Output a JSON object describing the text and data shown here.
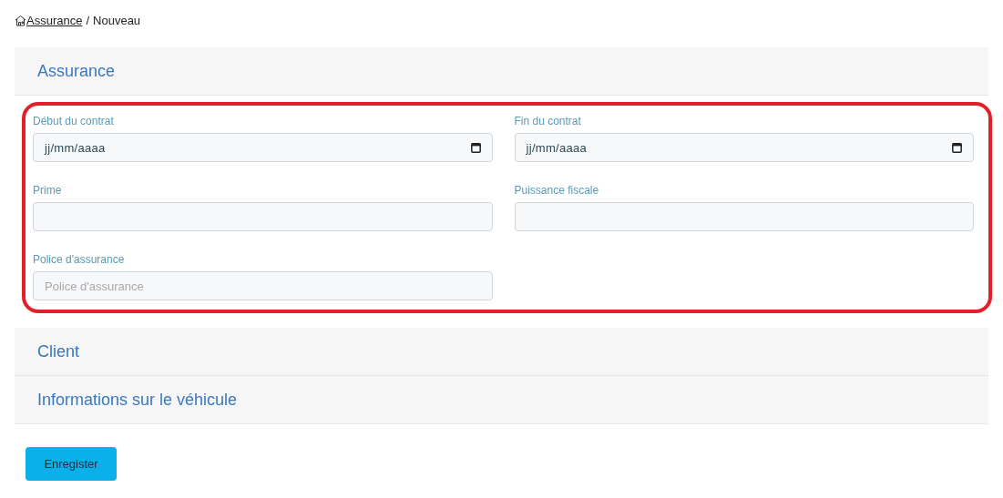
{
  "breadcrumb": {
    "link": "Assurance",
    "separator": "/",
    "current": "Nouveau"
  },
  "sections": [
    {
      "title": "Assurance",
      "expanded": true,
      "highlighted": true,
      "fields": [
        {
          "kind": "date",
          "label": "Début du contrat",
          "value": "jj/mm/aaaa"
        },
        {
          "kind": "date",
          "label": "Fin du contrat",
          "value": "jj/mm/aaaa"
        },
        {
          "kind": "text",
          "label": "Prime"
        },
        {
          "kind": "text",
          "label": "Puissance fiscale"
        },
        {
          "kind": "text",
          "label": "Police d'assurance",
          "placeholder": "Police d'assurance"
        }
      ]
    },
    {
      "title": "Client",
      "expanded": false
    },
    {
      "title": "Informations sur le véhicule",
      "expanded": false
    }
  ],
  "save_button": "Enregister"
}
